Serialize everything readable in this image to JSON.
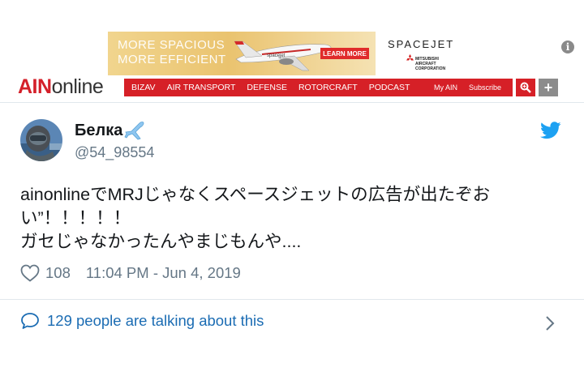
{
  "ad": {
    "line1": "MORE SPACIOUS",
    "line2": "MORE EFFICIENT",
    "plane_label": "spacejet",
    "cta": "LEARN MORE",
    "brand": "SPACEJET",
    "maker": "MITSUBISHI AIRCRAFT CORPORATION"
  },
  "site": {
    "logo_ain": "AIN",
    "logo_online": "online",
    "nav": [
      "BIZAV",
      "AIR TRANSPORT",
      "DEFENSE",
      "ROTORCRAFT",
      "PODCAST"
    ],
    "my_ain": "My AIN",
    "subscribe": "Subscribe",
    "plus": "+"
  },
  "tweet": {
    "name": "Белка",
    "name_emoji": "✈️",
    "handle": "@54_98554",
    "text_lines": [
      "ainonlineでMRJじゃなくスペースジェットの広告が出たぞお",
      "い”！！！！！",
      "ガセじゃなかったんやまじもんや...."
    ],
    "likes": "108",
    "timestamp": "11:04 PM - Jun 4, 2019",
    "talking": "129 people are talking about this"
  },
  "colors": {
    "brand_red": "#d62027",
    "twitter_blue": "#1da1f2",
    "link_blue": "#1b6cb3",
    "muted": "#657786"
  },
  "icons": {
    "info": "i",
    "search": "zoom-icon",
    "heart": "heart-icon",
    "bubble": "speech-bubble-icon",
    "chevron": "chevron-right-icon",
    "bird": "twitter-bird-icon"
  }
}
